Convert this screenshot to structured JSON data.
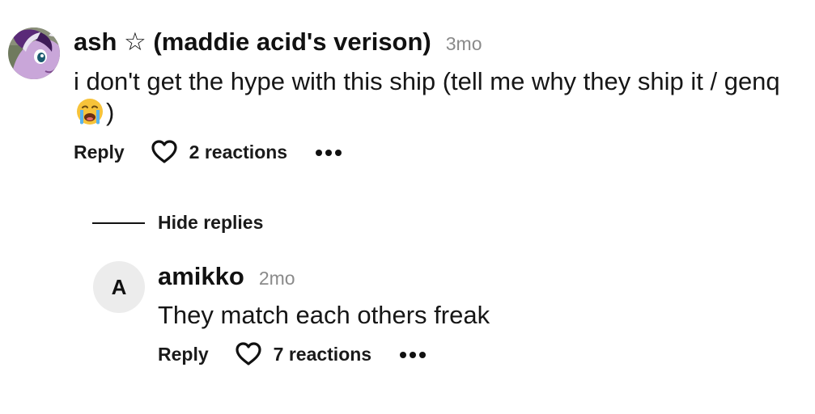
{
  "comment": {
    "author": "ash ☆ (maddie acid's verison)",
    "time": "3mo",
    "text_before_emoji": "i don't get the hype with this ship (tell me why they ship it / genq ",
    "emoji_icon": "loudly-crying-face-emoji",
    "text_after_emoji": ")",
    "reply_label": "Reply",
    "reactions_label": "2 reactions",
    "more_icon": "more-dots-icon",
    "heart_icon": "heart-icon"
  },
  "hide_replies": {
    "label": "Hide replies"
  },
  "reply": {
    "avatar_initial": "A",
    "author": "amikko",
    "time": "2mo",
    "text": "They match each others freak",
    "reply_label": "Reply",
    "reactions_label": "7 reactions"
  },
  "colors": {
    "text": "#111111",
    "muted": "#8a8a8a",
    "avatar_placeholder": "#ececec"
  }
}
